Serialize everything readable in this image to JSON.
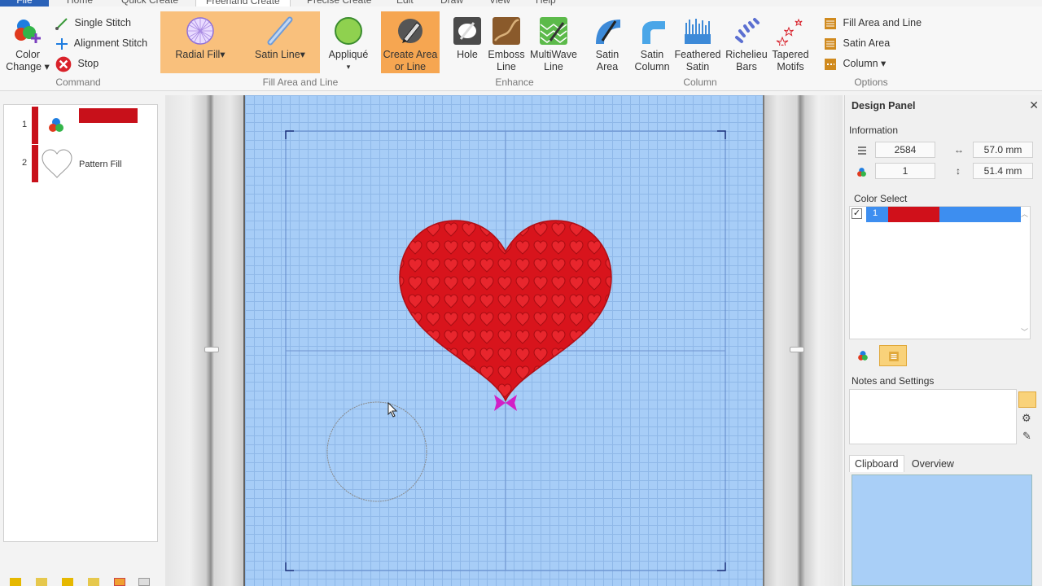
{
  "tabs": [
    {
      "label": "File"
    },
    {
      "label": "Home"
    },
    {
      "label": "Quick Create"
    },
    {
      "label": "Freehand Create"
    },
    {
      "label": "Precise Create"
    },
    {
      "label": "Edit"
    },
    {
      "label": "Draw"
    },
    {
      "label": "View"
    },
    {
      "label": "Help"
    }
  ],
  "ribbon": {
    "command": {
      "label": "Command",
      "color_change": "Color Change",
      "single_stitch": "Single Stitch",
      "alignment_stitch": "Alignment Stitch",
      "stop": "Stop"
    },
    "fill_area_line": {
      "label": "Fill Area and Line",
      "radial_fill": "Radial Fill",
      "satin_line": "Satin Line",
      "applique": "Appliqué",
      "create_area": "Create Area or Line"
    },
    "enhance": {
      "label": "Enhance",
      "hole": "Hole",
      "emboss_line": "Emboss Line",
      "multiwave_line": "MultiWave Line"
    },
    "column": {
      "label": "Column",
      "satin_area": "Satin Area",
      "satin_column": "Satin Column",
      "feathered_satin": "Feathered Satin",
      "richelieu_bars": "Richelieu Bars",
      "tapered_motifs": "Tapered Motifs"
    },
    "options": {
      "label": "Options",
      "fill_area_and_line": "Fill Area and Line",
      "satin_area": "Satin Area",
      "column": "Column"
    }
  },
  "sequence": [
    {
      "num": "1",
      "label": ""
    },
    {
      "num": "2",
      "label": "Pattern Fill"
    }
  ],
  "design_panel": {
    "title": "Design Panel",
    "information_label": "Information",
    "stitches": "2584",
    "width": "57.0 mm",
    "colors": "1",
    "height": "51.4 mm",
    "color_select_label": "Color Select",
    "color_entry": "1",
    "notes_label": "Notes and Settings",
    "clipboard_tab": "Clipboard",
    "overview_tab": "Overview"
  },
  "colors": {
    "accent": "#c8101a",
    "fabric": "#a7cdf7",
    "selection": "#3d8ef0",
    "highlight": "#f9c07c"
  }
}
